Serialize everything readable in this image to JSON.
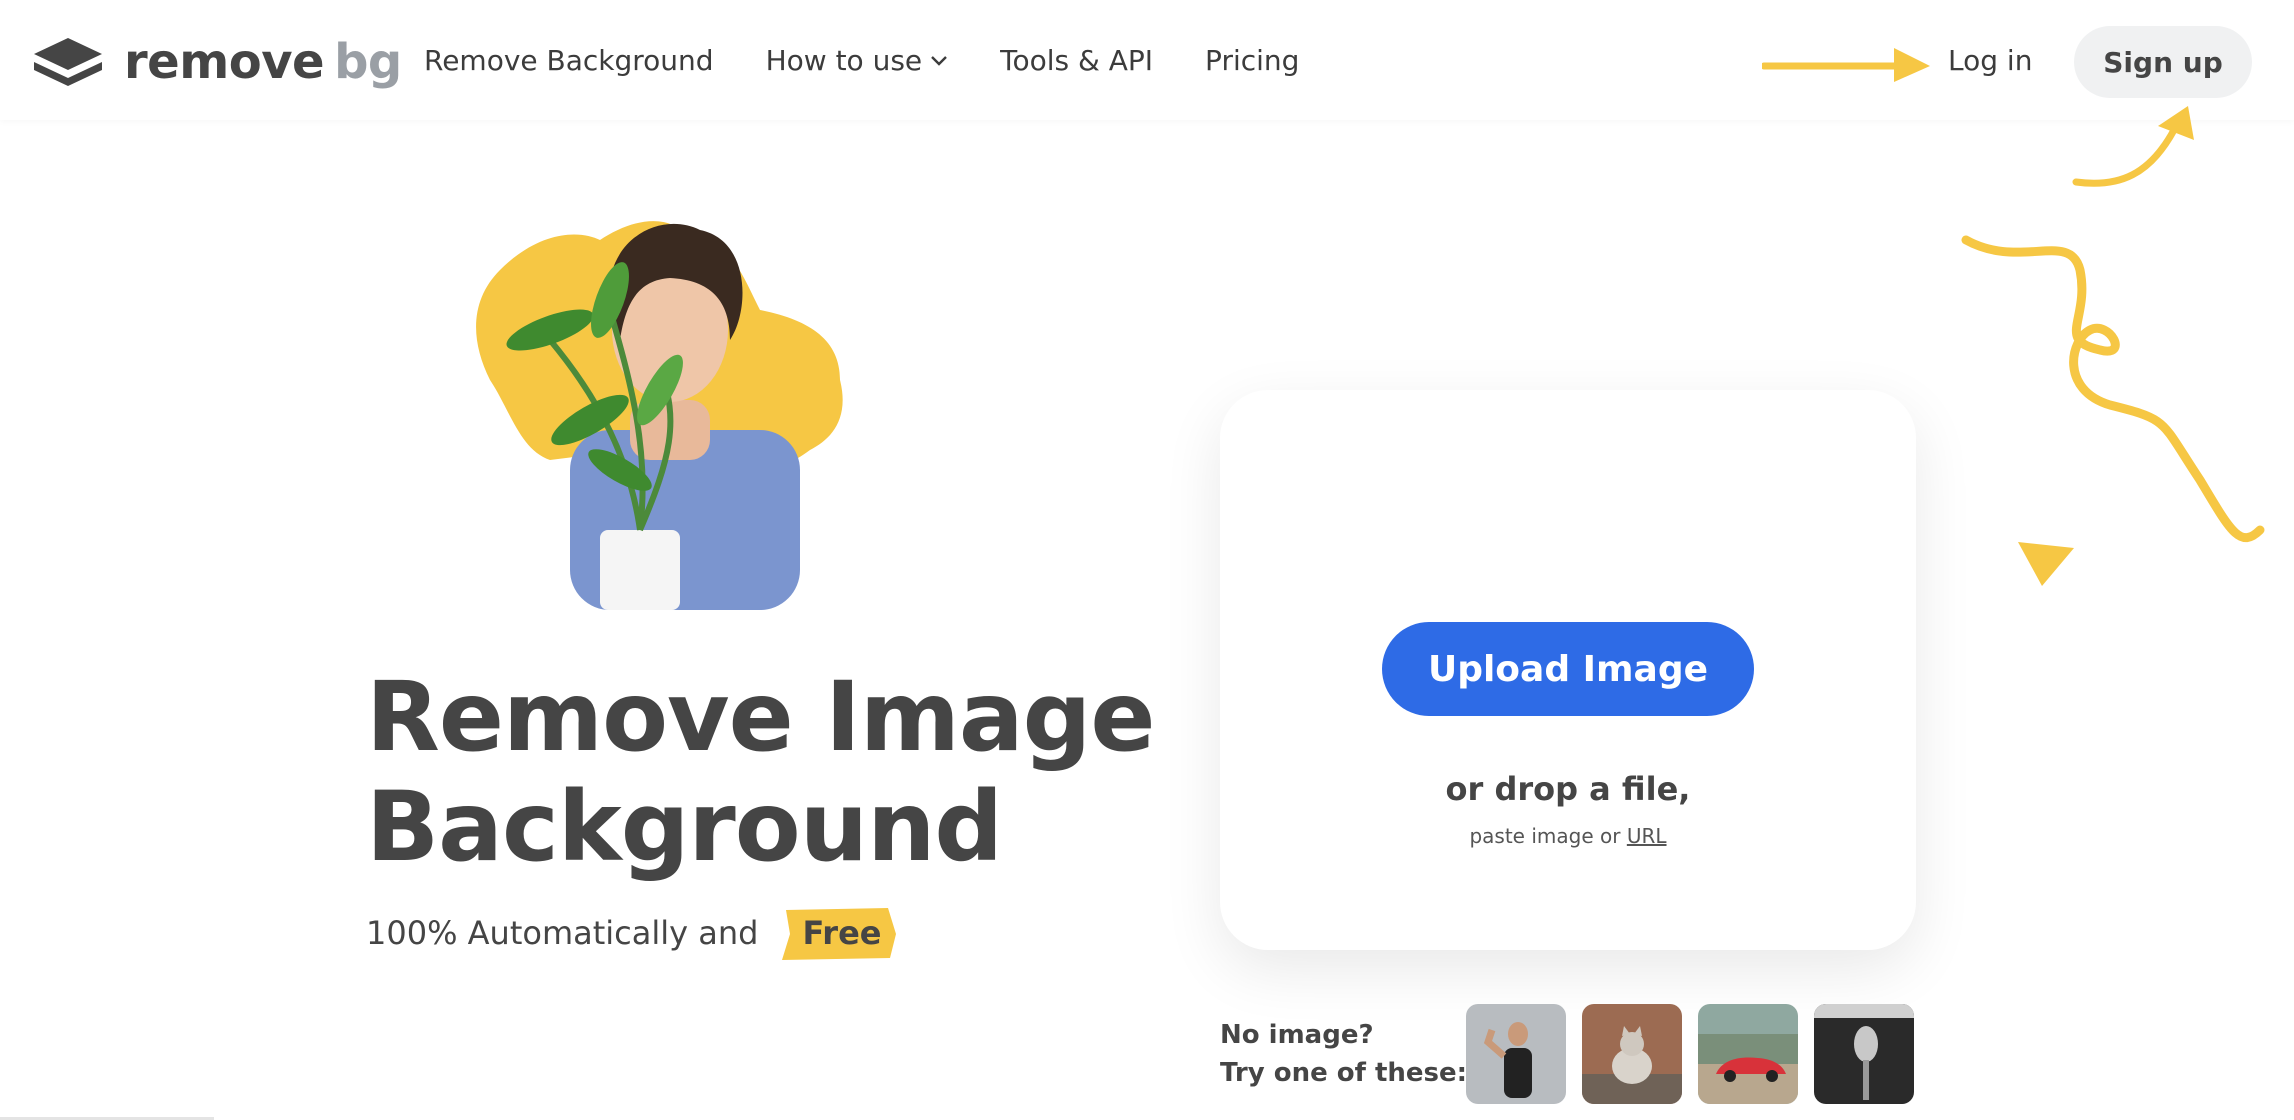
{
  "header": {
    "logo": {
      "part1": "remove",
      "part2": "bg"
    },
    "nav": [
      {
        "label": "Remove Background"
      },
      {
        "label": "How to use"
      },
      {
        "label": "Tools & API"
      },
      {
        "label": "Pricing"
      }
    ],
    "login_label": "Log in",
    "signup_label": "Sign up"
  },
  "hero": {
    "title_line1": "Remove Image",
    "title_line2": "Background",
    "tagline": "100% Automatically and",
    "free_label": "Free"
  },
  "upload": {
    "button_label": "Upload Image",
    "drop_text": "or drop a file,",
    "paste_text": "paste image or",
    "url_link": "URL"
  },
  "samples": {
    "line1": "No image?",
    "line2": "Try one of these:",
    "items": [
      "woman-flexing",
      "cat",
      "red-car",
      "microphone"
    ]
  },
  "colors": {
    "accent": "#2e6be6",
    "yellow": "#f6c744",
    "text": "#454545"
  }
}
